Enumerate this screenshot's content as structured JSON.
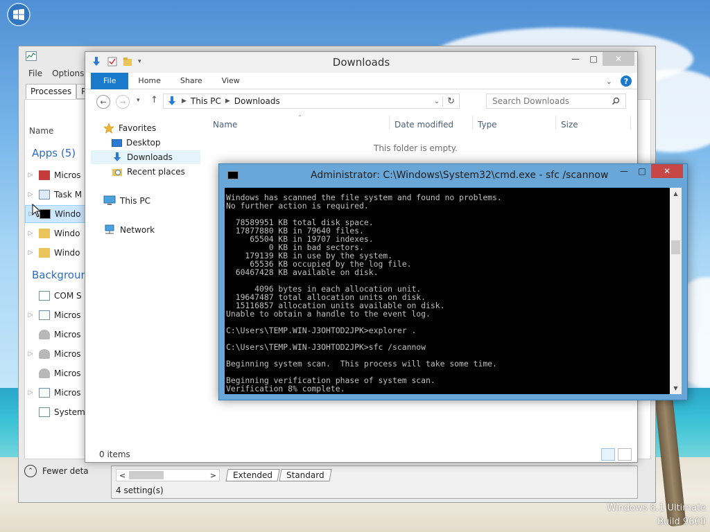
{
  "desktop": {
    "watermark_line1": "Windows 8.1 Ultimate",
    "watermark_line2": "Build 9600"
  },
  "taskmgr": {
    "menu": [
      "File",
      "Options"
    ],
    "tabs": [
      "Processes",
      "Per"
    ],
    "column_name": "Name",
    "group_apps": "Apps (5)",
    "apps": [
      "Micros",
      "Task M",
      "Windo",
      "Windo",
      "Windo"
    ],
    "group_background": "Backgroun",
    "background": [
      "COM S",
      "Micros",
      "Micros",
      "Micros",
      "Micros",
      "Micros",
      "System"
    ],
    "fewer_details": "Fewer deta"
  },
  "settings_strip": {
    "tabs": [
      "Extended",
      "Standard"
    ],
    "status": "4 setting(s)"
  },
  "explorer": {
    "title": "Downloads",
    "ribbon_tabs": [
      "File",
      "Home",
      "Share",
      "View"
    ],
    "address": [
      "This PC",
      "Downloads"
    ],
    "search_placeholder": "Search Downloads",
    "nav": {
      "favorites": "Favorites",
      "desktop": "Desktop",
      "downloads": "Downloads",
      "recent": "Recent places",
      "this_pc": "This PC",
      "network": "Network"
    },
    "columns": [
      "Name",
      "Date modified",
      "Type",
      "Size"
    ],
    "empty_message": "This folder is empty.",
    "status": "0 items"
  },
  "cmd": {
    "title": "Administrator: C:\\Windows\\System32\\cmd.exe - sfc  /scannow",
    "output": "Windows has scanned the file system and found no problems.\nNo further action is required.\n\n  78589951 KB total disk space.\n  17877880 KB in 79640 files.\n     65504 KB in 19707 indexes.\n         0 KB in bad sectors.\n    179139 KB in use by the system.\n     65536 KB occupied by the log file.\n  60467428 KB available on disk.\n\n      4096 bytes in each allocation unit.\n  19647487 total allocation units on disk.\n  15116857 allocation units available on disk.\nUnable to obtain a handle to the event log.\n\nC:\\Users\\TEMP.WIN-J3OHTOD2JPK>explorer .\n\nC:\\Users\\TEMP.WIN-J3OHTOD2JPK>sfc /scannow\n\nBeginning system scan.  This process will take some time.\n\nBeginning verification phase of system scan.\nVerification 8% complete."
  }
}
